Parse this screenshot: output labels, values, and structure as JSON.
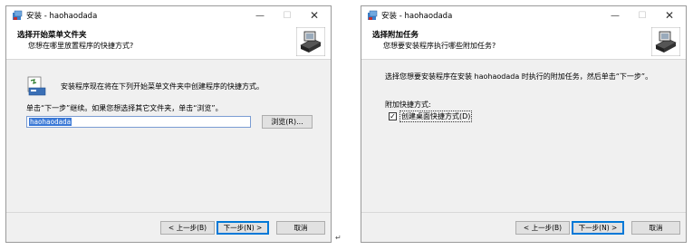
{
  "window1": {
    "title": "安装 - haohaodada",
    "header_title": "选择开始菜单文件夹",
    "header_subtitle": "您想在哪里放置程序的快捷方式?",
    "intro": "安装程序现在将在下列开始菜单文件夹中创建程序的快捷方式。",
    "continue_hint": "单击“下一步”继续。如果您想选择其它文件夹，单击“浏览”。",
    "folder_value": "haohaodada",
    "browse_label": "浏览(R)...",
    "back_label": "< 上一步(B)",
    "next_label": "下一步(N) >",
    "cancel_label": "取消"
  },
  "window2": {
    "title": "安装 - haohaodada",
    "header_title": "选择附加任务",
    "header_subtitle": "您想要安装程序执行哪些附加任务?",
    "intro": "选择您想要安装程序在安装 haohaodada 时执行的附加任务，然后单击“下一步”。",
    "group_label": "附加快捷方式:",
    "checkbox_label": "创建桌面快捷方式(D)",
    "checkbox_checked": true,
    "checkbox_mark": "✓",
    "back_label": "< 上一步(B)",
    "next_label": "下一步(N) >",
    "cancel_label": "取消"
  },
  "window_controls": {
    "minimize": "—",
    "maximize": "☐",
    "close": "✕"
  },
  "paragraph_mark": "↵",
  "colors": {
    "header_bg": "#ffffff",
    "body_bg": "#f0f0f0",
    "focus": "#0078d7",
    "selection": "#3a78d6"
  },
  "icons": [
    "installer-app-icon",
    "installer-logo-icon",
    "start-menu-folder-icon",
    "checkbox-checked-icon"
  ]
}
